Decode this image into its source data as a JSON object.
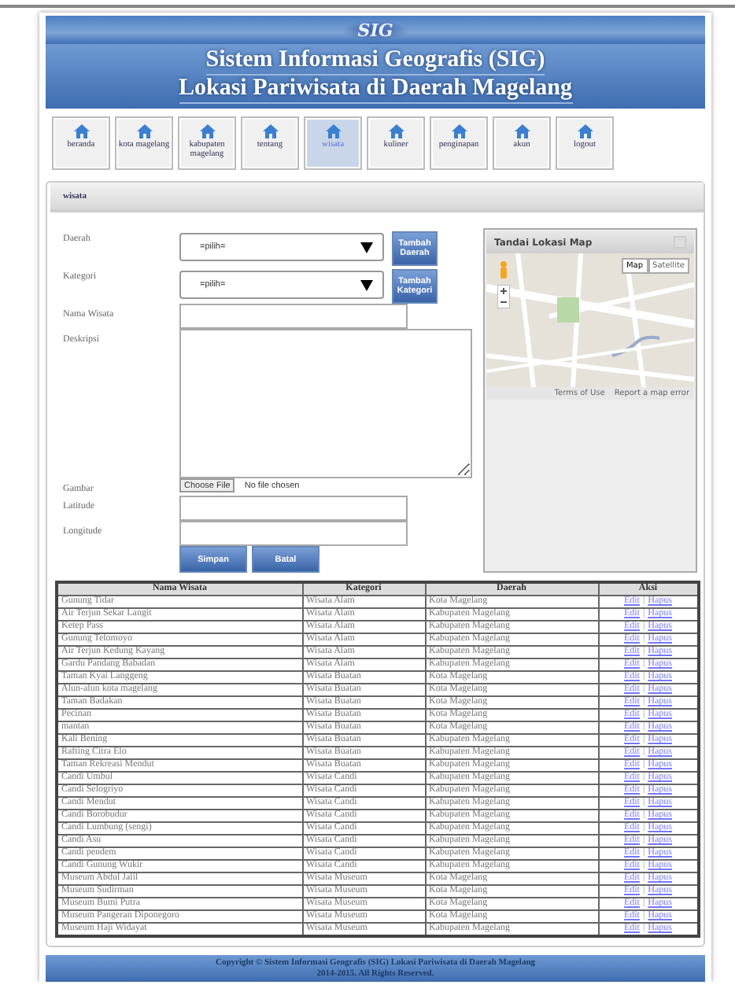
{
  "header": {
    "logo": "SIG",
    "title_lines": [
      "Sistem Informasi Geografis (SIG)",
      "Lokasi Pariwisata di Daerah Magelang"
    ]
  },
  "nav": [
    {
      "label": "beranda",
      "selected": false
    },
    {
      "label": "kota magelang",
      "selected": false
    },
    {
      "label": "kabupaten magelang",
      "selected": false
    },
    {
      "label": "tentang",
      "selected": false
    },
    {
      "label": "wisata",
      "selected": true
    },
    {
      "label": "kuliner",
      "selected": false
    },
    {
      "label": "penginapan",
      "selected": false
    },
    {
      "label": "akun",
      "selected": false
    },
    {
      "label": "logout",
      "selected": false
    }
  ],
  "panel": {
    "title": "wisata"
  },
  "form": {
    "fields": [
      {
        "kind": "select",
        "label": "Daerah",
        "value": "=pilih=",
        "button": "Tambah Daerah"
      },
      {
        "kind": "select",
        "label": "Kategori",
        "value": "=pilih=",
        "button": "Tambah Kategori"
      },
      {
        "kind": "text",
        "label": "Nama Wisata"
      },
      {
        "kind": "textarea",
        "label": "Deskripsi"
      },
      {
        "kind": "file",
        "label": "Gambar",
        "button": "Choose File",
        "status": "No file chosen"
      },
      {
        "kind": "text",
        "label": "Latitude"
      },
      {
        "kind": "text",
        "label": "Longitude"
      }
    ],
    "buttons": [
      "Simpan",
      "Batal"
    ]
  },
  "map": {
    "title": "Tandai Lokasi Map",
    "types": [
      {
        "label": "Map",
        "selected": true
      },
      {
        "label": "Satellite",
        "selected": false
      }
    ],
    "footer": [
      "Terms of Use",
      "Report a map error"
    ]
  },
  "table": {
    "columns": [
      "Nama Wisata",
      "Kategori",
      "Daerah",
      "Aksi"
    ],
    "action_separator": "|",
    "rows": [
      {
        "cells": [
          "Gunung Tidar",
          "Wisata Alam",
          "Kota Magelang"
        ],
        "actions": [
          "Edit",
          "Hapus"
        ]
      },
      {
        "cells": [
          "Air Terjun Sekar Langit",
          "Wisata Alam",
          "Kabupaten Magelang"
        ],
        "actions": [
          "Edit",
          "Hapus"
        ]
      },
      {
        "cells": [
          "Ketep Pass",
          "Wisata Alam",
          "Kabupaten Magelang"
        ],
        "actions": [
          "Edit",
          "Hapus"
        ]
      },
      {
        "cells": [
          "Gunung Telomoyo",
          "Wisata Alam",
          "Kabupaten Magelang"
        ],
        "actions": [
          "Edit",
          "Hapus"
        ]
      },
      {
        "cells": [
          "Air Terjun Kedung Kayang",
          "Wisata Alam",
          "Kabupaten Magelang"
        ],
        "actions": [
          "Edit",
          "Hapus"
        ]
      },
      {
        "cells": [
          "Gardu Pandang Babadan",
          "Wisata Alam",
          "Kabupaten Magelang"
        ],
        "actions": [
          "Edit",
          "Hapus"
        ]
      },
      {
        "cells": [
          "Taman Kyai Langgeng",
          "Wisata Buatan",
          "Kota Magelang"
        ],
        "actions": [
          "Edit",
          "Hapus"
        ]
      },
      {
        "cells": [
          "Alun-alun kota magelang",
          "Wisata Buatan",
          "Kota Magelang"
        ],
        "actions": [
          "Edit",
          "Hapus"
        ]
      },
      {
        "cells": [
          "Taman Badakan",
          "Wisata Buatan",
          "Kota Magelang"
        ],
        "actions": [
          "Edit",
          "Hapus"
        ]
      },
      {
        "cells": [
          "Pecinan",
          "Wisata Buatan",
          "Kota Magelang"
        ],
        "actions": [
          "Edit",
          "Hapus"
        ]
      },
      {
        "cells": [
          "mantan",
          "Wisata Buatan",
          "Kota Magelang"
        ],
        "actions": [
          "Edit",
          "Hapus"
        ]
      },
      {
        "cells": [
          "Kali Bening",
          "Wisata Buatan",
          "Kabupaten Magelang"
        ],
        "actions": [
          "Edit",
          "Hapus"
        ]
      },
      {
        "cells": [
          "Rafting Citra Elo",
          "Wisata Buatan",
          "Kabupaten Magelang"
        ],
        "actions": [
          "Edit",
          "Hapus"
        ]
      },
      {
        "cells": [
          "Taman Rekreasi Mendut",
          "Wisata Buatan",
          "Kabupaten Magelang"
        ],
        "actions": [
          "Edit",
          "Hapus"
        ]
      },
      {
        "cells": [
          "Candi Umbul",
          "Wisata Candi",
          "Kabupaten Magelang"
        ],
        "actions": [
          "Edit",
          "Hapus"
        ]
      },
      {
        "cells": [
          "Candi Selogriyo",
          "Wisata Candi",
          "Kabupaten Magelang"
        ],
        "actions": [
          "Edit",
          "Hapus"
        ]
      },
      {
        "cells": [
          "Candi Mendut",
          "Wisata Candi",
          "Kabupaten Magelang"
        ],
        "actions": [
          "Edit",
          "Hapus"
        ]
      },
      {
        "cells": [
          "Candi Borobudur",
          "Wisata Candi",
          "Kabupaten Magelang"
        ],
        "actions": [
          "Edit",
          "Hapus"
        ]
      },
      {
        "cells": [
          "Candi Lumbung (sengi)",
          "Wisata Candi",
          "Kabupaten Magelang"
        ],
        "actions": [
          "Edit",
          "Hapus"
        ]
      },
      {
        "cells": [
          "Candi Asu",
          "Wisata Candi",
          "Kabupaten Magelang"
        ],
        "actions": [
          "Edit",
          "Hapus"
        ]
      },
      {
        "cells": [
          "Candi pendem",
          "Wisata Candi",
          "Kabupaten Magelang"
        ],
        "actions": [
          "Edit",
          "Hapus"
        ]
      },
      {
        "cells": [
          "Candi Gunung Wukir",
          "Wisata Candi",
          "Kabupaten Magelang"
        ],
        "actions": [
          "Edit",
          "Hapus"
        ]
      },
      {
        "cells": [
          "Museum Abdul Jalil",
          "Wisata Museum",
          "Kota Magelang"
        ],
        "actions": [
          "Edit",
          "Hapus"
        ]
      },
      {
        "cells": [
          "Museum Sudirman",
          "Wisata Museum",
          "Kota Magelang"
        ],
        "actions": [
          "Edit",
          "Hapus"
        ]
      },
      {
        "cells": [
          "Museum Bumi Putra",
          "Wisata Museum",
          "Kota Magelang"
        ],
        "actions": [
          "Edit",
          "Hapus"
        ]
      },
      {
        "cells": [
          "Museum Pangeran Diponegoro",
          "Wisata Museum",
          "Kota Magelang"
        ],
        "actions": [
          "Edit",
          "Hapus"
        ]
      },
      {
        "cells": [
          "Museum Haji Widayat",
          "Wisata Museum",
          "Kabupaten Magelang"
        ],
        "actions": [
          "Edit",
          "Hapus"
        ]
      }
    ]
  },
  "footer": {
    "lines": [
      "Copyright © Sistem Informasi Geografis (SIG) Lokasi Pariwisata di Daerah Magelang",
      "2014-2015. All Rights Reserved."
    ]
  }
}
